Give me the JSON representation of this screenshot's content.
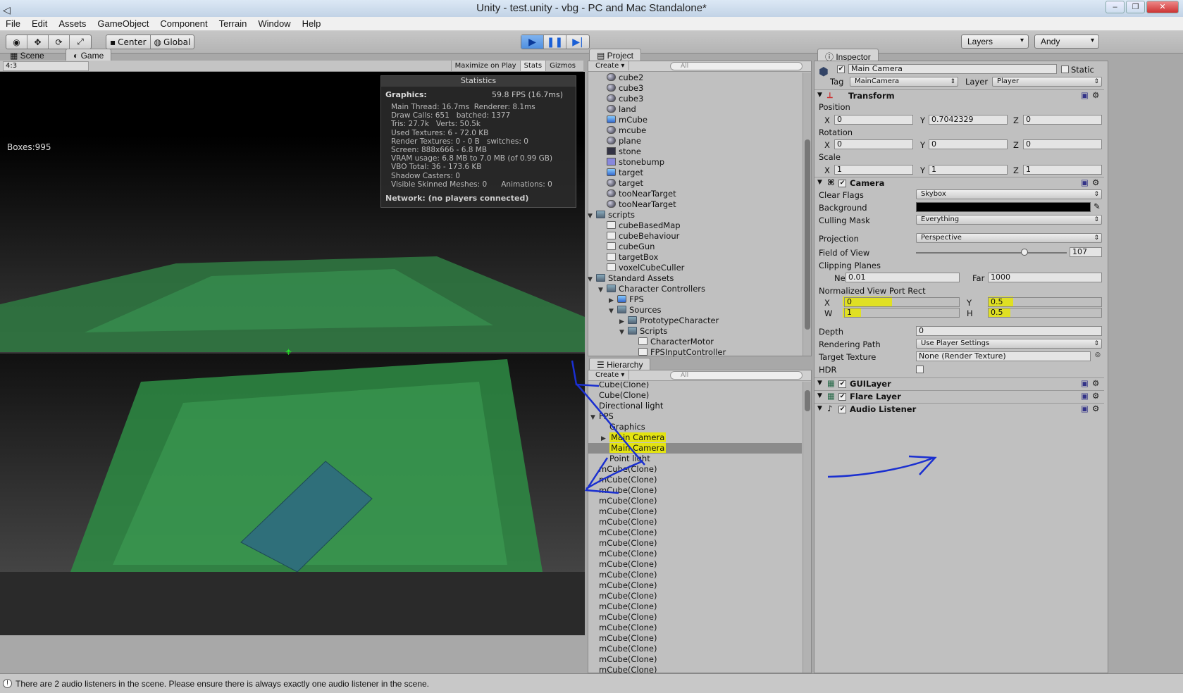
{
  "window": {
    "title": "Unity - test.unity - vbg - PC and Mac Standalone*"
  },
  "menu": [
    "File",
    "Edit",
    "Assets",
    "GameObject",
    "Component",
    "Terrain",
    "Window",
    "Help"
  ],
  "toolbar": {
    "center": "Center",
    "global": "Global",
    "layers": "Layers",
    "layout": "Andy"
  },
  "tabs": {
    "scene": "Scene",
    "game": "Game",
    "project": "Project",
    "hierarchy": "Hierarchy",
    "inspector": "Inspector"
  },
  "game": {
    "aspect": "4:3",
    "maximize": "Maximize on Play",
    "stats_btn": "Stats",
    "gizmos": "Gizmos",
    "boxes": "Boxes:995",
    "statistics": {
      "title": "Statistics",
      "graphics": "Graphics:",
      "fps": "59.8 FPS (16.7ms)",
      "lines": "Main Thread: 16.7ms  Renderer: 8.1ms\nDraw Calls: 651   batched: 1377\nTris: 27.7k   Verts: 50.5k\nUsed Textures: 6 - 72.0 KB\nRender Textures: 0 - 0 B   switches: 0\nScreen: 888x666 - 6.8 MB\nVRAM usage: 6.8 MB to 7.0 MB (of 0.99 GB)\nVBO Total: 36 - 173.6 KB\nShadow Casters: 0\nVisible Skinned Meshes: 0      Animations: 0",
      "network": "Network: (no players connected)"
    }
  },
  "project": {
    "create": "Create",
    "search_placeholder": "All",
    "rows": [
      {
        "indent": 1,
        "icon": "sphere",
        "label": "cube2"
      },
      {
        "indent": 1,
        "icon": "sphere",
        "label": "cube3"
      },
      {
        "indent": 1,
        "icon": "sphere",
        "label": "cube3"
      },
      {
        "indent": 1,
        "icon": "sphere",
        "label": "land"
      },
      {
        "indent": 1,
        "icon": "prefab",
        "label": "mCube"
      },
      {
        "indent": 1,
        "icon": "sphere",
        "label": "mcube"
      },
      {
        "indent": 1,
        "icon": "sphere",
        "label": "plane"
      },
      {
        "indent": 1,
        "icon": "texture",
        "label": "stone"
      },
      {
        "indent": 1,
        "icon": "texture2",
        "label": "stonebump"
      },
      {
        "indent": 1,
        "icon": "prefab",
        "label": "target"
      },
      {
        "indent": 1,
        "icon": "sphere",
        "label": "target"
      },
      {
        "indent": 1,
        "icon": "sphere",
        "label": "tooNearTarget"
      },
      {
        "indent": 1,
        "icon": "sphere",
        "label": "tooNearTarget"
      },
      {
        "indent": 0,
        "icon": "folder",
        "label": "scripts",
        "open": true
      },
      {
        "indent": 1,
        "icon": "script",
        "label": "cubeBasedMap"
      },
      {
        "indent": 1,
        "icon": "script",
        "label": "cubeBehaviour"
      },
      {
        "indent": 1,
        "icon": "script",
        "label": "cubeGun"
      },
      {
        "indent": 1,
        "icon": "script",
        "label": "targetBox"
      },
      {
        "indent": 1,
        "icon": "script",
        "label": "voxelCubeCuller"
      },
      {
        "indent": 0,
        "icon": "folder",
        "label": "Standard Assets",
        "open": true
      },
      {
        "indent": 1,
        "icon": "folder",
        "label": "Character Controllers",
        "open": true
      },
      {
        "indent": 2,
        "icon": "prefab",
        "label": "FPS",
        "closed": true
      },
      {
        "indent": 2,
        "icon": "folder",
        "label": "Sources",
        "open": true
      },
      {
        "indent": 3,
        "icon": "folder",
        "label": "PrototypeCharacter",
        "closed": true
      },
      {
        "indent": 3,
        "icon": "folder",
        "label": "Scripts",
        "open": true
      },
      {
        "indent": 4,
        "icon": "script",
        "label": "CharacterMotor"
      },
      {
        "indent": 4,
        "icon": "script",
        "label": "FPSInputController"
      }
    ]
  },
  "hierarchy": {
    "create": "Create",
    "search_placeholder": "All",
    "rows": [
      {
        "indent": 0,
        "label": "Cube(Clone)"
      },
      {
        "indent": 0,
        "label": "Cube(Clone)"
      },
      {
        "indent": 0,
        "label": "Directional light"
      },
      {
        "indent": 0,
        "label": "FPS",
        "open": true
      },
      {
        "indent": 1,
        "label": "Graphics"
      },
      {
        "indent": 1,
        "label": "Main Camera",
        "highlight": true,
        "closed": true
      },
      {
        "indent": 1,
        "label": "Main Camera",
        "highlight": true,
        "selected": true
      },
      {
        "indent": 1,
        "label": "Point light"
      },
      {
        "indent": 0,
        "label": "mCube(Clone)"
      },
      {
        "indent": 0,
        "label": "mCube(Clone)"
      },
      {
        "indent": 0,
        "label": "mCube(Clone)"
      },
      {
        "indent": 0,
        "label": "mCube(Clone)"
      },
      {
        "indent": 0,
        "label": "mCube(Clone)"
      },
      {
        "indent": 0,
        "label": "mCube(Clone)"
      },
      {
        "indent": 0,
        "label": "mCube(Clone)"
      },
      {
        "indent": 0,
        "label": "mCube(Clone)"
      },
      {
        "indent": 0,
        "label": "mCube(Clone)"
      },
      {
        "indent": 0,
        "label": "mCube(Clone)"
      },
      {
        "indent": 0,
        "label": "mCube(Clone)"
      },
      {
        "indent": 0,
        "label": "mCube(Clone)"
      },
      {
        "indent": 0,
        "label": "mCube(Clone)"
      },
      {
        "indent": 0,
        "label": "mCube(Clone)"
      },
      {
        "indent": 0,
        "label": "mCube(Clone)"
      },
      {
        "indent": 0,
        "label": "mCube(Clone)"
      },
      {
        "indent": 0,
        "label": "mCube(Clone)"
      },
      {
        "indent": 0,
        "label": "mCube(Clone)"
      },
      {
        "indent": 0,
        "label": "mCube(Clone)"
      },
      {
        "indent": 0,
        "label": "mCube(Clone)"
      },
      {
        "indent": 0,
        "label": "mCube(Clone)"
      },
      {
        "indent": 0,
        "label": "mCube(Clone)"
      },
      {
        "indent": 0,
        "label": "mCube(Clone)"
      }
    ]
  },
  "inspector": {
    "object_name": "Main Camera",
    "static": "Static",
    "tag_label": "Tag",
    "tag": "MainCamera",
    "layer_label": "Layer",
    "layer": "Player",
    "transform": {
      "title": "Transform",
      "position": "Position",
      "pos": [
        "0",
        "0.7042329",
        "0"
      ],
      "rotation": "Rotation",
      "rot": [
        "0",
        "0",
        "0"
      ],
      "scale": "Scale",
      "scl": [
        "1",
        "1",
        "1"
      ],
      "axes": [
        "X",
        "Y",
        "Z"
      ]
    },
    "camera": {
      "title": "Camera",
      "clear_flags": "Clear Flags",
      "clear_flags_val": "Skybox",
      "background": "Background",
      "culling_mask": "Culling Mask",
      "culling_mask_val": "Everything",
      "projection": "Projection",
      "projection_val": "Perspective",
      "fov": "Field of View",
      "fov_val": "107",
      "fov_slider": 0.72,
      "clipping": "Clipping Planes",
      "near": "Near",
      "near_val": "0.01",
      "far": "Far",
      "far_val": "1000",
      "viewport": "Normalized View Port Rect",
      "vx": "X",
      "vx_val": "0",
      "vy": "Y",
      "vy_val": "0.5",
      "vw": "W",
      "vw_val": "1",
      "vh": "H",
      "vh_val": "0.5",
      "depth": "Depth",
      "depth_val": "0",
      "rendering_path": "Rendering Path",
      "rendering_path_val": "Use Player Settings",
      "target_texture": "Target Texture",
      "target_texture_val": "None (Render Texture)",
      "hdr": "HDR"
    },
    "components": [
      "GUILayer",
      "Flare Layer",
      "Audio Listener"
    ]
  },
  "status": "There are 2 audio listeners in the scene. Please ensure there is always exactly one audio listener in the scene.",
  "colors": {
    "highlight": "#e3e312",
    "ink": "#1a2fd0",
    "selected_row": "#8b8b8b"
  }
}
